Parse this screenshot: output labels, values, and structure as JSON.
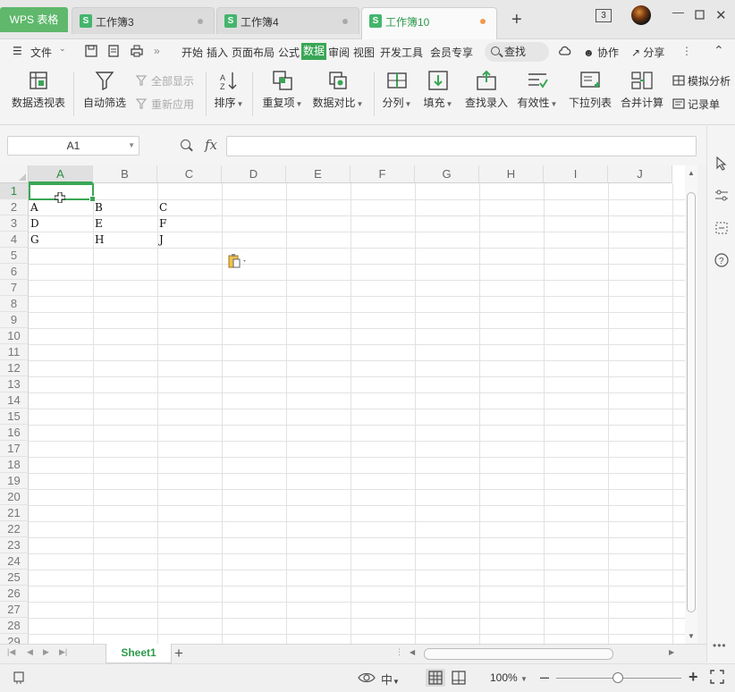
{
  "titlebar": {
    "app_tab": "WPS 表格",
    "tabs": [
      {
        "icon": "S",
        "label": "工作簿3"
      },
      {
        "icon": "S",
        "label": "工作簿4"
      },
      {
        "icon": "S",
        "label": "工作簿10"
      }
    ],
    "window_count": "3"
  },
  "menubar": {
    "file": "文件",
    "items": [
      "开始",
      "插入",
      "页面布局",
      "公式",
      "数据",
      "审阅",
      "视图",
      "开发工具",
      "会员专享"
    ],
    "active": "数据",
    "search": "查找",
    "collab": "协作",
    "share": "分享"
  },
  "ribbon": {
    "pivot": "数据透视表",
    "autofilter": "自动筛选",
    "show_all": "全部显示",
    "reapply": "重新应用",
    "sort": "排序",
    "duplicates": "重复项",
    "compare": "数据对比",
    "split": "分列",
    "fill": "填充",
    "lookup": "查找录入",
    "validity": "有效性",
    "dropdown": "下拉列表",
    "consolidate": "合并计算",
    "simulate": "模拟分析",
    "record": "记录单"
  },
  "formula": {
    "cell_ref": "A1",
    "fx": "fx",
    "value": ""
  },
  "grid": {
    "columns": [
      "A",
      "B",
      "C",
      "D",
      "E",
      "F",
      "G",
      "H",
      "I",
      "J"
    ],
    "rows": [
      "1",
      "2",
      "3",
      "4",
      "5",
      "6",
      "7",
      "8",
      "9",
      "10",
      "11",
      "12",
      "13",
      "14",
      "15",
      "16",
      "17",
      "18",
      "19",
      "20",
      "21",
      "22",
      "23",
      "24",
      "25",
      "26",
      "27",
      "28",
      "29"
    ],
    "cells": [
      [
        "",
        "",
        ""
      ],
      [
        "A",
        "B",
        "C"
      ],
      [
        "D",
        "E",
        "F"
      ],
      [
        "G",
        "H",
        "J"
      ]
    ]
  },
  "sheets": {
    "active": "Sheet1",
    "add": "+"
  },
  "status": {
    "zoom": "100%"
  },
  "colors": {
    "accent": "#3aa655",
    "app_tab": "#5fb86c"
  }
}
